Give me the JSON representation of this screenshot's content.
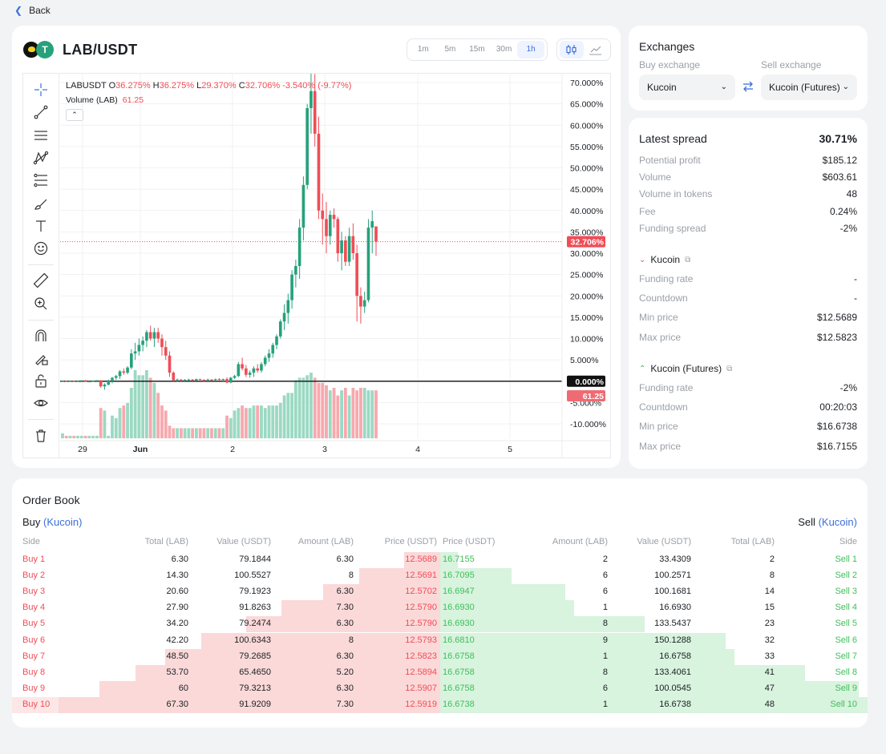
{
  "nav": {
    "back_label": "Back"
  },
  "pair": {
    "title": "LAB/USDT"
  },
  "timeframes": [
    "1m",
    "5m",
    "15m",
    "30m",
    "1h"
  ],
  "active_timeframe": "1h",
  "chart": {
    "legend": {
      "symbol": "LABUSDT",
      "o_label": "O",
      "o": "36.275%",
      "h_label": "H",
      "h": "36.275%",
      "l_label": "L",
      "l": "29.370%",
      "c_label": "C",
      "c": "32.706%",
      "change": "-3.540% (-9.77%)"
    },
    "volume_legend": {
      "label": "Volume (LAB)",
      "value": "61.25"
    },
    "y_ticks": [
      "70.000%",
      "65.000%",
      "60.000%",
      "55.000%",
      "50.000%",
      "45.000%",
      "40.000%",
      "35.000%",
      "30.000%",
      "25.000%",
      "20.000%",
      "15.000%",
      "10.000%",
      "5.000%",
      "0.000%",
      "-5.000%",
      "-10.000%"
    ],
    "x_ticks": [
      "29",
      "Jun",
      "2",
      "3",
      "4",
      "5"
    ],
    "price_label": "32.706%",
    "zero_label": "0.000%",
    "volume_label": "61.25",
    "colors": {
      "up": "#26a17b",
      "down": "#ef4d56"
    }
  },
  "chart_data": {
    "type": "candlestick",
    "ylim": [
      -10,
      70
    ],
    "x_ticks": [
      "29",
      "Jun",
      "2",
      "3",
      "4",
      "5"
    ],
    "last_close": 32.706,
    "candles": [
      [
        0.1,
        0.2,
        -0.1,
        0.1
      ],
      [
        0.1,
        0.2,
        0.0,
        0.0
      ],
      [
        0.0,
        0.1,
        -0.1,
        0.1
      ],
      [
        0.1,
        0.1,
        -0.1,
        0.0
      ],
      [
        0.0,
        0.2,
        -0.2,
        0.1
      ],
      [
        0.1,
        0.2,
        0.0,
        0.2
      ],
      [
        0.2,
        0.3,
        -0.2,
        -0.1
      ],
      [
        -0.1,
        0.1,
        -0.3,
        0.0
      ],
      [
        0.0,
        0.2,
        -0.1,
        0.1
      ],
      [
        0.1,
        0.3,
        0.0,
        0.2
      ],
      [
        0.2,
        0.3,
        -1.5,
        -1.2
      ],
      [
        -1.2,
        -0.5,
        -2.0,
        -0.8
      ],
      [
        -0.8,
        0.4,
        -1.0,
        0.2
      ],
      [
        0.2,
        1.0,
        -0.5,
        0.8
      ],
      [
        0.8,
        1.5,
        0.3,
        1.2
      ],
      [
        1.2,
        2.6,
        0.5,
        2.3
      ],
      [
        2.3,
        3.0,
        1.5,
        2.0
      ],
      [
        2.0,
        3.5,
        1.6,
        3.2
      ],
      [
        3.2,
        7.5,
        2.8,
        6.5
      ],
      [
        6.5,
        9.0,
        5.0,
        7.0
      ],
      [
        7.0,
        10.0,
        6.0,
        8.5
      ],
      [
        8.5,
        10.5,
        7.0,
        9.5
      ],
      [
        9.5,
        12.0,
        8.0,
        11.5
      ],
      [
        11.5,
        13.0,
        9.5,
        10.0
      ],
      [
        10.0,
        12.5,
        8.0,
        11.5
      ],
      [
        11.5,
        12.5,
        9.0,
        10.0
      ],
      [
        10.0,
        11.0,
        6.0,
        8.0
      ],
      [
        8.0,
        9.5,
        5.0,
        6.0
      ],
      [
        6.0,
        7.0,
        1.0,
        2.0
      ],
      [
        2.0,
        2.3,
        0.0,
        0.2
      ],
      [
        0.2,
        0.6,
        -0.1,
        0.4
      ],
      [
        0.4,
        0.5,
        0.0,
        0.2
      ],
      [
        0.2,
        0.5,
        0.0,
        0.3
      ],
      [
        0.3,
        0.6,
        0.1,
        0.4
      ],
      [
        0.4,
        0.5,
        0.1,
        0.2
      ],
      [
        0.2,
        0.6,
        0.1,
        0.5
      ],
      [
        0.5,
        0.6,
        0.2,
        0.3
      ],
      [
        0.3,
        0.5,
        0.0,
        0.2
      ],
      [
        0.2,
        0.6,
        0.0,
        0.4
      ],
      [
        0.4,
        0.5,
        0.1,
        0.3
      ],
      [
        0.3,
        0.6,
        0.1,
        0.5
      ],
      [
        0.5,
        0.7,
        0.2,
        0.3
      ],
      [
        0.3,
        0.6,
        0.0,
        0.5
      ],
      [
        0.5,
        0.9,
        -0.5,
        -0.3
      ],
      [
        -0.3,
        1.0,
        -0.5,
        0.8
      ],
      [
        0.8,
        1.5,
        0.5,
        1.2
      ],
      [
        1.2,
        4.5,
        1.0,
        4.0
      ],
      [
        4.0,
        5.5,
        2.5,
        3.0
      ],
      [
        3.0,
        3.8,
        1.0,
        1.5
      ],
      [
        1.5,
        2.5,
        0.8,
        2.0
      ],
      [
        2.0,
        3.5,
        1.0,
        3.0
      ],
      [
        3.0,
        4.0,
        2.0,
        2.5
      ],
      [
        2.5,
        4.5,
        2.0,
        4.0
      ],
      [
        4.0,
        6.0,
        3.5,
        5.5
      ],
      [
        5.5,
        7.5,
        4.5,
        6.5
      ],
      [
        6.5,
        9.0,
        5.5,
        8.5
      ],
      [
        8.5,
        11.0,
        7.5,
        10.5
      ],
      [
        10.5,
        14.5,
        10.0,
        14.0
      ],
      [
        14.0,
        18.0,
        12.0,
        16.0
      ],
      [
        16.0,
        20.5,
        13.5,
        19.0
      ],
      [
        19.0,
        26.0,
        17.0,
        25.0
      ],
      [
        25.0,
        28.5,
        22.0,
        27.0
      ],
      [
        27.0,
        38.0,
        24.0,
        36.0
      ],
      [
        36.0,
        48.0,
        33.0,
        46.0
      ],
      [
        46.0,
        65.0,
        45.0,
        64.0
      ],
      [
        64.0,
        75.0,
        58.0,
        68.0
      ],
      [
        68.0,
        72.0,
        55.0,
        58.0
      ],
      [
        58.0,
        62.0,
        38.0,
        40.0
      ],
      [
        40.0,
        44.0,
        32.0,
        38.0
      ],
      [
        38.0,
        42.0,
        30.0,
        34.0
      ],
      [
        34.0,
        40.0,
        32.0,
        39.0
      ],
      [
        39.0,
        40.5,
        36.0,
        38.0
      ],
      [
        38.0,
        38.5,
        28.0,
        30.0
      ],
      [
        30.0,
        35.0,
        26.0,
        33.0
      ],
      [
        33.0,
        34.0,
        27.0,
        28.0
      ],
      [
        28.0,
        36.0,
        27.0,
        34.0
      ],
      [
        34.0,
        37.0,
        28.5,
        30.0
      ],
      [
        30.0,
        32.0,
        14.0,
        20.0
      ],
      [
        20.0,
        22.0,
        13.5,
        17.5
      ],
      [
        17.5,
        21.0,
        16.0,
        19.0
      ],
      [
        19.0,
        38.0,
        18.5,
        36.0
      ],
      [
        36.0,
        40.0,
        30.0,
        37.5
      ],
      [
        36.275,
        36.275,
        29.37,
        32.706
      ]
    ],
    "volumes": [
      2,
      1,
      1,
      1,
      1,
      1,
      1,
      1,
      1,
      1,
      12,
      11,
      1,
      9,
      8,
      12,
      13,
      14,
      20,
      27,
      25,
      25,
      27,
      24,
      22,
      18,
      13,
      11,
      5,
      4,
      4,
      4,
      4,
      4,
      4,
      4,
      4,
      4,
      4,
      4,
      4,
      4,
      4,
      9,
      8,
      11,
      12,
      13,
      12,
      12,
      13,
      13,
      13,
      12,
      13,
      13,
      13,
      14,
      17,
      18,
      18,
      23,
      24,
      24,
      25,
      26,
      24,
      22,
      22,
      21,
      19,
      20,
      17,
      19,
      20,
      17,
      20,
      19,
      20,
      20,
      19,
      19,
      19,
      19,
      20
    ]
  },
  "exchanges": {
    "title": "Exchanges",
    "buy_label": "Buy exchange",
    "sell_label": "Sell exchange",
    "buy_value": "Kucoin",
    "sell_value": "Kucoin (Futures)"
  },
  "spread": {
    "title": "Latest spread",
    "value": "30.71%",
    "rows": [
      {
        "label": "Potential profit",
        "value": "$185.12"
      },
      {
        "label": "Volume",
        "value": "$603.61"
      },
      {
        "label": "Volume in tokens",
        "value": "48"
      },
      {
        "label": "Fee",
        "value": "0.24%"
      },
      {
        "label": "Funding spread",
        "value": "-2%"
      }
    ],
    "buy_ex": {
      "name": "Kucoin",
      "rows": [
        {
          "label": "Funding rate",
          "value": "-"
        },
        {
          "label": "Countdown",
          "value": "-"
        },
        {
          "label": "Min price",
          "value": "$12.5689"
        },
        {
          "label": "Max price",
          "value": "$12.5823"
        }
      ]
    },
    "sell_ex": {
      "name": "Kucoin (Futures)",
      "rows": [
        {
          "label": "Funding rate",
          "value": "-2%"
        },
        {
          "label": "Countdown",
          "value": "00:20:03"
        },
        {
          "label": "Min price",
          "value": "$16.6738"
        },
        {
          "label": "Max price",
          "value": "$16.7155"
        }
      ]
    },
    "colors": {
      "down": "#ef4d56",
      "up": "#3fbf5a"
    }
  },
  "orderbook": {
    "title": "Order Book",
    "buy_title": "Buy",
    "buy_ex": "(Kucoin)",
    "sell_title": "Sell",
    "sell_ex": "(Kucoin)",
    "headers": {
      "side": "Side",
      "total": "Total (LAB)",
      "value": "Value (USDT)",
      "amount": "Amount (LAB)",
      "price": "Price (USDT)",
      "s_price": "Price (USDT)",
      "s_amount": "Amount (LAB)",
      "s_value": "Value (USDT)",
      "s_total": "Total (LAB)",
      "s_side": "Side"
    },
    "rows": [
      {
        "b_side": "Buy 1",
        "b_total": "6.30",
        "b_value": "79.1844",
        "b_amount": "6.30",
        "b_price": "12.5689",
        "s_price": "16.7155",
        "s_amount": "2",
        "s_value": "33.4309",
        "s_total": "2",
        "s_side": "Sell 1",
        "b_depth": 0.094,
        "s_depth": 0.042
      },
      {
        "b_side": "Buy 2",
        "b_total": "14.30",
        "b_value": "100.5527",
        "b_amount": "8",
        "b_price": "12.5691",
        "s_price": "16.7095",
        "s_amount": "6",
        "s_value": "100.2571",
        "s_total": "8",
        "s_side": "Sell 2",
        "b_depth": 0.213,
        "s_depth": 0.167
      },
      {
        "b_side": "Buy 3",
        "b_total": "20.60",
        "b_value": "79.1923",
        "b_amount": "6.30",
        "b_price": "12.5702",
        "s_price": "16.6947",
        "s_amount": "6",
        "s_value": "100.1681",
        "s_total": "14",
        "s_side": "Sell 3",
        "b_depth": 0.306,
        "s_depth": 0.292
      },
      {
        "b_side": "Buy 4",
        "b_total": "27.90",
        "b_value": "91.8263",
        "b_amount": "7.30",
        "b_price": "12.5790",
        "s_price": "16.6930",
        "s_amount": "1",
        "s_value": "16.6930",
        "s_total": "15",
        "s_side": "Sell 4",
        "b_depth": 0.415,
        "s_depth": 0.313
      },
      {
        "b_side": "Buy 5",
        "b_total": "34.20",
        "b_value": "79.2474",
        "b_amount": "6.30",
        "b_price": "12.5790",
        "s_price": "16.6930",
        "s_amount": "8",
        "s_value": "133.5437",
        "s_total": "23",
        "s_side": "Sell 5",
        "b_depth": 0.508,
        "s_depth": 0.479
      },
      {
        "b_side": "Buy 6",
        "b_total": "42.20",
        "b_value": "100.6343",
        "b_amount": "8",
        "b_price": "12.5793",
        "s_price": "16.6810",
        "s_amount": "9",
        "s_value": "150.1288",
        "s_total": "32",
        "s_side": "Sell 6",
        "b_depth": 0.627,
        "s_depth": 0.667
      },
      {
        "b_side": "Buy 7",
        "b_total": "48.50",
        "b_value": "79.2685",
        "b_amount": "6.30",
        "b_price": "12.5823",
        "s_price": "16.6758",
        "s_amount": "1",
        "s_value": "16.6758",
        "s_total": "33",
        "s_side": "Sell 7",
        "b_depth": 0.721,
        "s_depth": 0.688
      },
      {
        "b_side": "Buy 8",
        "b_total": "53.70",
        "b_value": "65.4650",
        "b_amount": "5.20",
        "b_price": "12.5894",
        "s_price": "16.6758",
        "s_amount": "8",
        "s_value": "133.4061",
        "s_total": "41",
        "s_side": "Sell 8",
        "b_depth": 0.798,
        "s_depth": 0.854
      },
      {
        "b_side": "Buy 9",
        "b_total": "60",
        "b_value": "79.3213",
        "b_amount": "6.30",
        "b_price": "12.5907",
        "s_price": "16.6758",
        "s_amount": "6",
        "s_value": "100.0545",
        "s_total": "47",
        "s_side": "Sell 9",
        "b_depth": 0.892,
        "s_depth": 0.979
      },
      {
        "b_side": "Buy 10",
        "b_total": "67.30",
        "b_value": "91.9209",
        "b_amount": "7.30",
        "b_price": "12.5919",
        "s_price": "16.6738",
        "s_amount": "1",
        "s_value": "16.6738",
        "s_total": "48",
        "s_side": "Sell 10",
        "b_depth": 1.0,
        "s_depth": 1.0
      }
    ],
    "colors": {
      "buy": "#ef4d56",
      "sell": "#3fbf5a",
      "buy_bar": "#fbd9d9",
      "sell_bar": "#d8f3de"
    }
  }
}
